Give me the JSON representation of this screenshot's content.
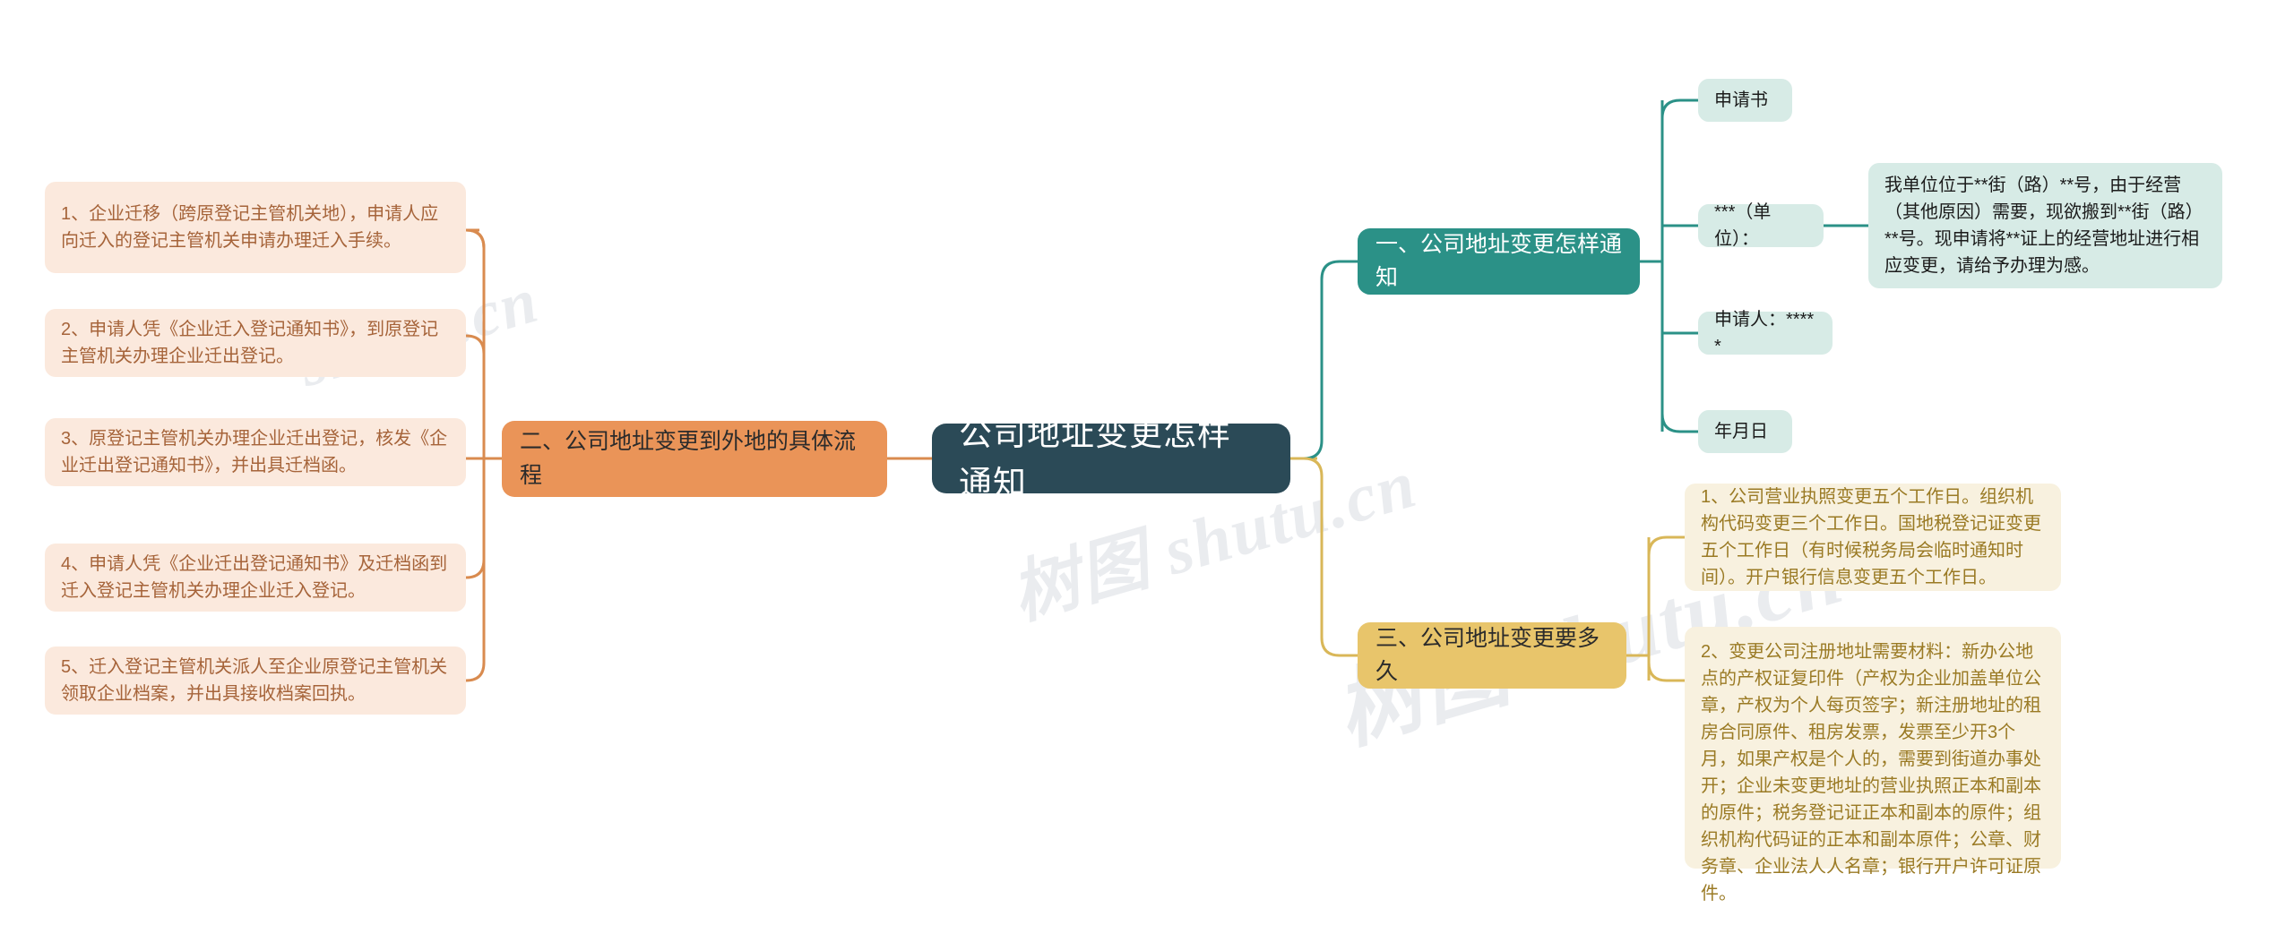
{
  "root": {
    "label": "公司地址变更怎样通知"
  },
  "watermarks": [
    "shutu.cn",
    "树图 shutu.cn",
    "树图 shutu.cn"
  ],
  "colors": {
    "root_bg": "#2b4a57",
    "branch_orange": "#ea9458",
    "branch_teal": "#2b9187",
    "branch_gold": "#e8c56b",
    "leaf_orange_bg": "#fbe9dd",
    "leaf_teal_bg": "#d7ebe6",
    "leaf_gold_bg": "#f8f1df",
    "link_orange": "#d98b4f",
    "link_teal": "#2b9187",
    "link_gold": "#d9b758"
  },
  "branches": {
    "left": {
      "label": "二、公司地址变更到外地的具体流程",
      "leaves": [
        {
          "text": "1、企业迁移（跨原登记主管机关地），申请人应向迁入的登记主管机关申请办理迁入手续。"
        },
        {
          "text": "2、申请人凭《企业迁入登记通知书》，到原登记主管机关办理企业迁出登记。"
        },
        {
          "text": "3、原登记主管机关办理企业迁出登记，核发《企业迁出登记通知书》，并出具迁档函。"
        },
        {
          "text": "4、申请人凭《企业迁出登记通知书》及迁档函到迁入登记主管机关办理企业迁入登记。"
        },
        {
          "text": "5、迁入登记主管机关派人至企业原登记主管机关领取企业档案，并出具接收档案回执。"
        }
      ]
    },
    "right_top": {
      "label": "一、公司地址变更怎样通知",
      "leaves": [
        {
          "text": "申请书"
        },
        {
          "text": "***（单位）："
        },
        {
          "text": "申请人：*****"
        },
        {
          "text": "年月日"
        }
      ],
      "detail": "我单位位于**街（路）**号，由于经营（其他原因）需要，现欲搬到**街（路）**号。现申请将**证上的经营地址进行相应变更，请给予办理为感。"
    },
    "right_bottom": {
      "label": "三、公司地址变更要多久",
      "leaves": [
        {
          "text": "1、公司营业执照变更五个工作日。组织机构代码变更三个工作日。国地税登记证变更五个工作日（有时候税务局会临时通知时间）。开户银行信息变更五个工作日。"
        },
        {
          "text": "2、变更公司注册地址需要材料：新办公地点的产权证复印件（产权为企业加盖单位公章，产权为个人每页签字；新注册地址的租房合同原件、租房发票，发票至少开3个月，如果产权是个人的，需要到街道办事处开；企业未变更地址的营业执照正本和副本的原件；税务登记证正本和副本的原件；组织机构代码证的正本和副本原件；公章、财务章、企业法人人名章；银行开户许可证原件。"
        }
      ]
    }
  }
}
